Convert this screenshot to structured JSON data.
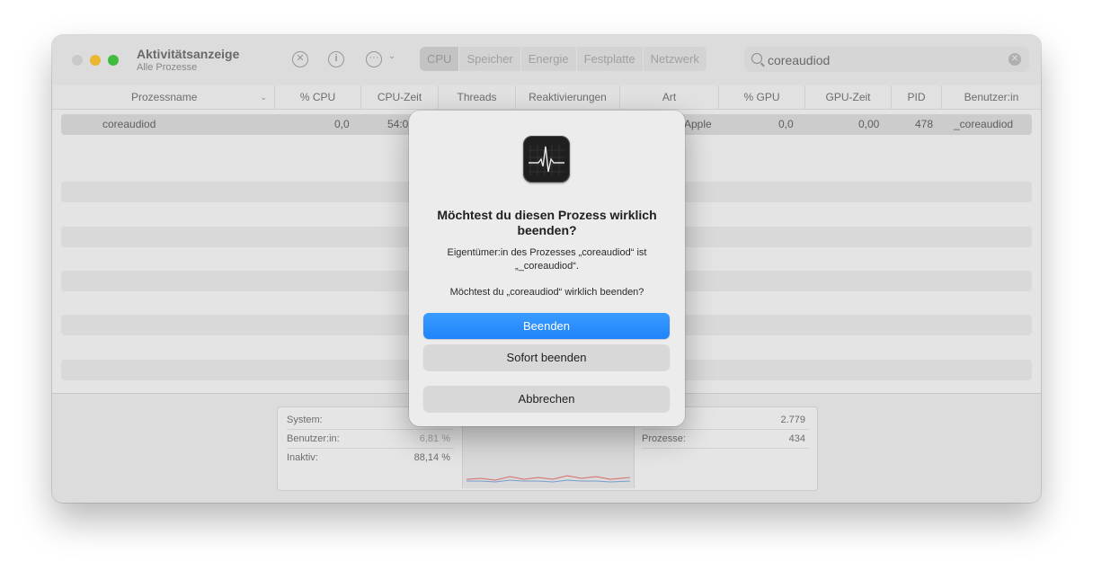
{
  "window": {
    "title": "Aktivitätsanzeige",
    "subtitle": "Alle Prozesse"
  },
  "toolbar": {
    "stop_icon": "x-circle-icon",
    "info_icon": "info-icon",
    "more_icon": "ellipsis-circle-icon",
    "tabs": [
      {
        "label": "CPU",
        "active": true
      },
      {
        "label": "Speicher",
        "active": false
      },
      {
        "label": "Energie",
        "active": false
      },
      {
        "label": "Festplatte",
        "active": false
      },
      {
        "label": "Netzwerk",
        "active": false
      }
    ]
  },
  "search": {
    "value": "coreaudiod"
  },
  "table": {
    "columns": [
      "Prozessname",
      "% CPU",
      "CPU-Zeit",
      "Threads",
      "Reaktivierungen",
      "Art",
      "% GPU",
      "GPU-Zeit",
      "PID",
      "Benutzer:in"
    ],
    "row": {
      "name": "coreaudiod",
      "cpu": "0,0",
      "cpu_time": "54:0",
      "art": "Apple",
      "gpu": "0,0",
      "gpu_time": "0,00",
      "pid": "478",
      "user": "_coreaudiod"
    }
  },
  "stats": {
    "system_label": "System:",
    "user_label": "Benutzer:in:",
    "user_value": "6,81 %",
    "idle_label": "Inaktiv:",
    "idle_value": "88,14 %",
    "threads_value": "2.779",
    "processes_label": "Prozesse:",
    "processes_value": "434"
  },
  "dialog": {
    "icon": "activity-monitor-app-icon",
    "title": "Möchtest du diesen Prozess wirklich beenden?",
    "text1": "Eigentümer:in des Prozesses „coreaudiod“ ist „_coreaudiod“.",
    "text2": "Möchtest du „coreaudiod“ wirklich beenden?",
    "quit_label": "Beenden",
    "force_quit_label": "Sofort beenden",
    "cancel_label": "Abbrechen"
  },
  "colors": {
    "accent": "#1f84fb",
    "close": "#d0d0d0",
    "minimize": "#f2bb2d",
    "maximize": "#3dc13c",
    "chart_line": "#e06a6a"
  }
}
